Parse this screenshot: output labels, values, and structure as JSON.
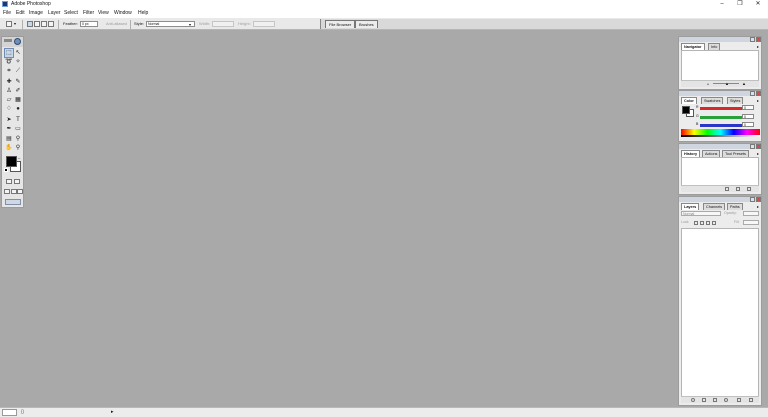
{
  "window": {
    "title": "Adobe Photoshop",
    "minimize": "–",
    "maximize": "❐",
    "close": "✕"
  },
  "menu": [
    "File",
    "Edit",
    "Image",
    "Layer",
    "Select",
    "Filter",
    "View",
    "Window",
    "Help"
  ],
  "options": {
    "feather_label": "Feather:",
    "feather_value": "0 px",
    "anti_aliased_label": "Anti-aliased",
    "style_label": "Style:",
    "style_value": "Normal",
    "width_label": "Width:",
    "height_label": "Height:"
  },
  "well_tabs": [
    "File Browser",
    "Brushes"
  ],
  "navigator": {
    "tabs": [
      "Navigator",
      "Info"
    ]
  },
  "color": {
    "tabs": [
      "Color",
      "Swatches",
      "Styles"
    ],
    "channels": [
      {
        "label": "R",
        "value": "0",
        "color": "#d42a2a"
      },
      {
        "label": "G",
        "value": "0",
        "color": "#2aa13a"
      },
      {
        "label": "B",
        "value": "0",
        "color": "#2a36c7"
      }
    ]
  },
  "history": {
    "tabs": [
      "History",
      "Actions",
      "Tool Presets"
    ]
  },
  "layers": {
    "tabs": [
      "Layers",
      "Channels",
      "Paths"
    ],
    "blend_mode": "Normal",
    "opacity_label": "Opacity:",
    "lock_label": "Lock:",
    "fill_label": "Fill:"
  },
  "colors": {
    "workspace": "#a9a9a9",
    "foreground": "#000000",
    "background": "#ffffff"
  },
  "icons": {
    "tools": [
      "marquee-tool-icon",
      "move-tool-icon",
      "lasso-tool-icon",
      "magic-wand-tool-icon",
      "crop-tool-icon",
      "slice-tool-icon",
      "healing-brush-icon",
      "brush-tool-icon",
      "clone-stamp-icon",
      "history-brush-icon",
      "eraser-tool-icon",
      "gradient-tool-icon",
      "blur-tool-icon",
      "dodge-tool-icon",
      "path-selection-icon",
      "type-tool-icon",
      "pen-tool-icon",
      "shape-tool-icon",
      "notes-tool-icon",
      "eyedropper-tool-icon",
      "hand-tool-icon",
      "zoom-tool-icon"
    ]
  }
}
